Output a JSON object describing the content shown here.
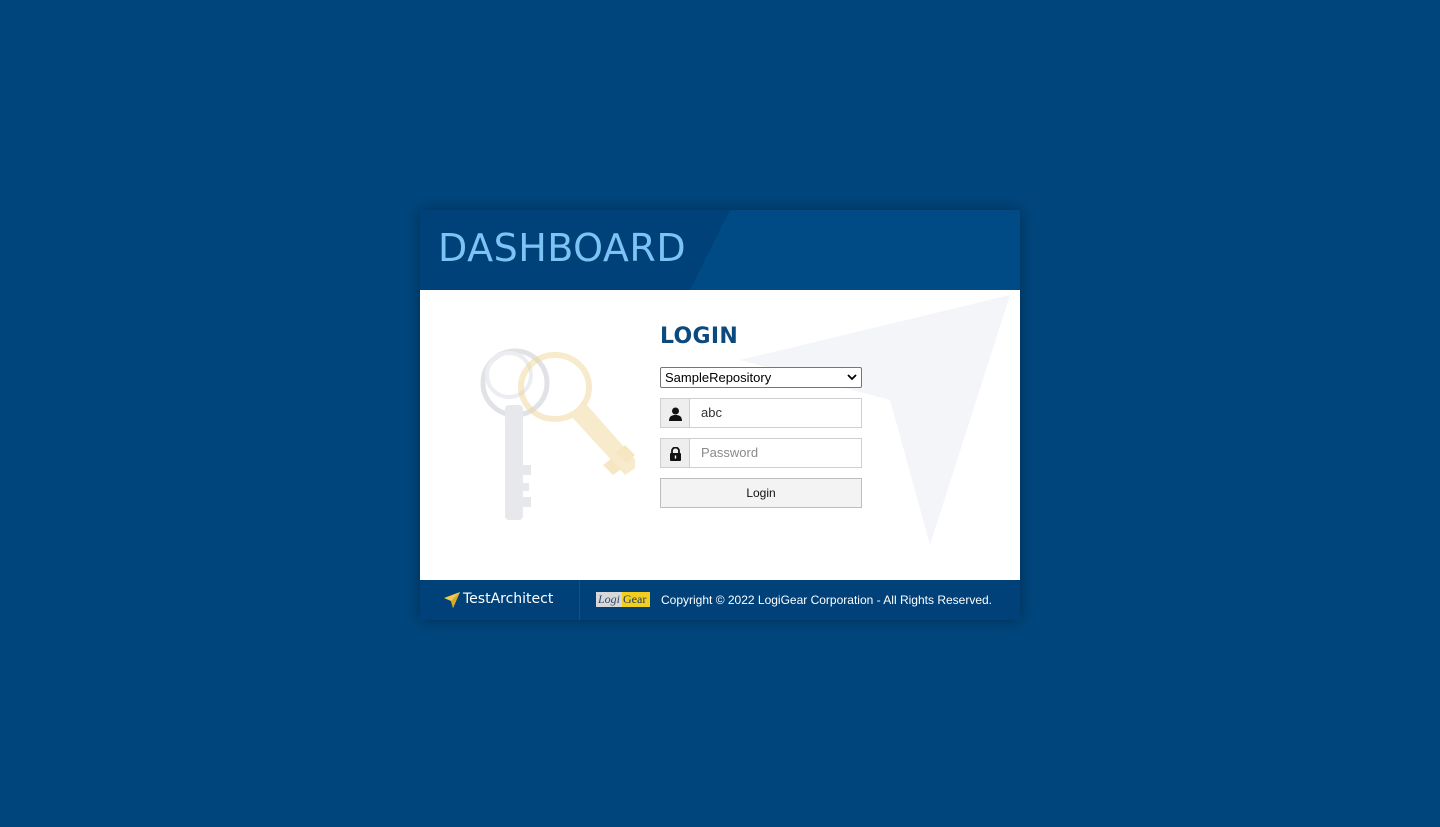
{
  "header": {
    "title": "DASHBOARD"
  },
  "login": {
    "title": "LOGIN",
    "repository": {
      "selected": "SampleRepository"
    },
    "username": {
      "value": "abc"
    },
    "password": {
      "placeholder": "Password",
      "value": ""
    },
    "submit_label": "Login"
  },
  "footer": {
    "product_name": "TestArchitect",
    "company_logo": {
      "part1": "Logi",
      "part2": "Gear"
    },
    "copyright": "Copyright © 2022 LogiGear Corporation - All Rights Reserved."
  },
  "icons": {
    "user": "user-icon",
    "lock": "lock-icon",
    "keys": "keys-icon",
    "dropdown": "chevron-down-icon",
    "logo_arrow": "paper-plane-icon"
  },
  "colors": {
    "page_background": "#00467d",
    "header_background": "#00417a",
    "title_accent": "#7cc4f4",
    "login_heading": "#0b4a7e",
    "logo_yellow": "#f2cf1e"
  }
}
